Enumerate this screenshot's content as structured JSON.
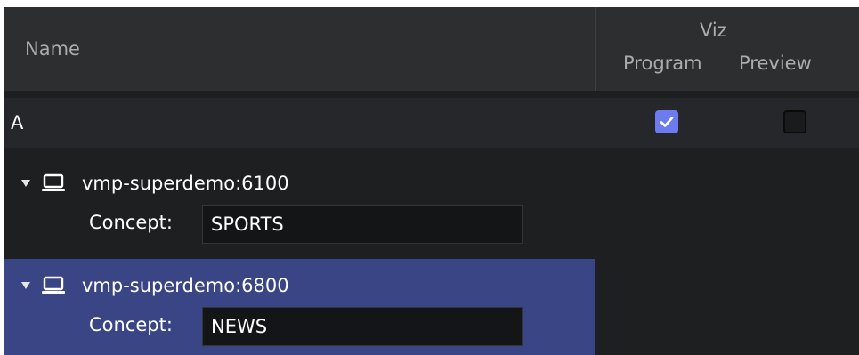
{
  "header": {
    "name_column": "Name",
    "viz_label": "Viz",
    "program_label": "Program",
    "preview_label": "Preview"
  },
  "group": {
    "label": "A",
    "program_checked": true,
    "preview_checked": false
  },
  "servers": [
    {
      "name": "vmp-superdemo:6100",
      "concept_label": "Concept:",
      "concept_value": "SPORTS",
      "selected": false,
      "icon": "laptop-icon"
    },
    {
      "name": "vmp-superdemo:6800",
      "concept_label": "Concept:",
      "concept_value": "NEWS",
      "selected": true,
      "icon": "laptop-icon"
    }
  ],
  "colors": {
    "background": "#1e1f21",
    "header": "#2d2e30",
    "selected_row": "#3a4585",
    "checkbox_accent": "#6c7cf0"
  }
}
